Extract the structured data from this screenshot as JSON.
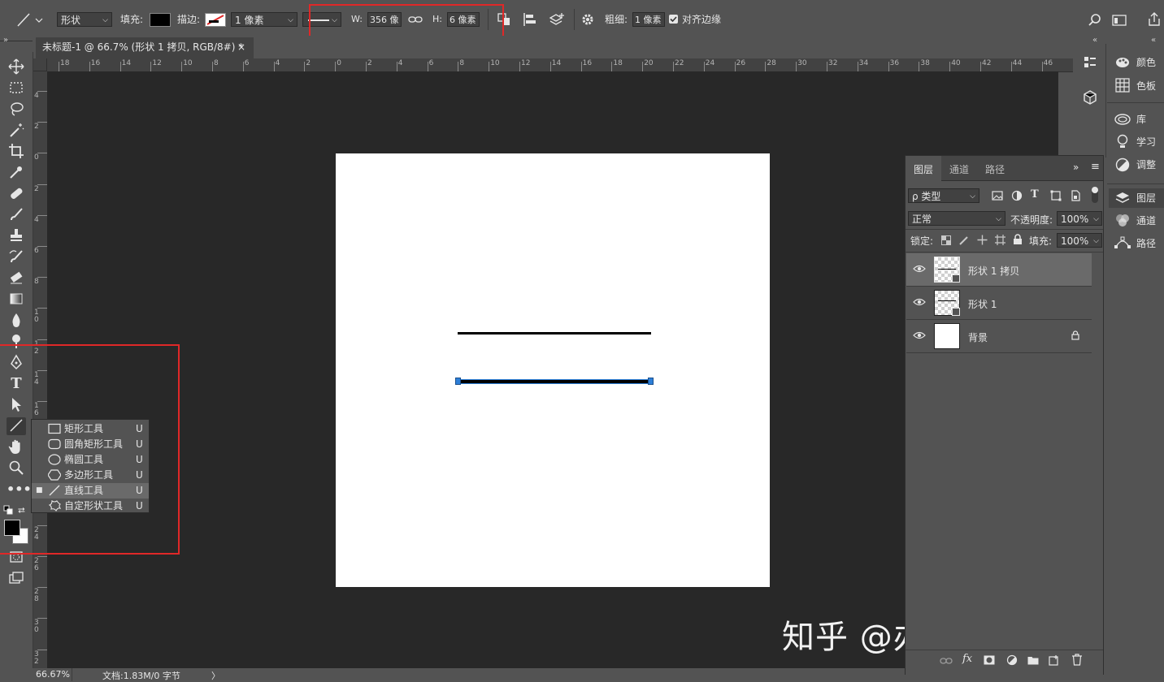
{
  "options_bar": {
    "mode": "形状",
    "fill_label": "填充:",
    "stroke_label": "描边:",
    "stroke_width": "1 像素",
    "w_label": "W:",
    "w_value": "356 像",
    "h_label": "H:",
    "h_value": "6 像素",
    "weight_label": "粗细:",
    "weight_value": "1 像素",
    "align_edges": "对齐边缘"
  },
  "document": {
    "tab_title": "未标题-1 @ 66.7% (形状 1 拷贝, RGB/8#) *",
    "tab_close": "×"
  },
  "ruler": {
    "h_ticks": [
      "18",
      "16",
      "14",
      "12",
      "10",
      "8",
      "6",
      "4",
      "2",
      "0",
      "2",
      "4",
      "6",
      "8",
      "10",
      "12",
      "14",
      "16",
      "18",
      "20",
      "22",
      "24",
      "26",
      "28",
      "30",
      "32",
      "34",
      "36",
      "38",
      "40",
      "42",
      "44",
      "46"
    ],
    "v_ticks": [
      "4",
      "2",
      "0",
      "2",
      "4",
      "6",
      "8",
      "1 0",
      "1 2",
      "1 4",
      "1 6",
      "1 8",
      "2 0",
      "2 2",
      "2 4",
      "2 6",
      "2 8",
      "3 0",
      "3 2"
    ]
  },
  "status": {
    "zoom": "66.67%",
    "doc_info": "文档:1.83M/0 字节",
    "arrow": "〉"
  },
  "tool_flyout": [
    {
      "label": "矩形工具",
      "key": "U"
    },
    {
      "label": "圆角矩形工具",
      "key": "U"
    },
    {
      "label": "椭圆工具",
      "key": "U"
    },
    {
      "label": "多边形工具",
      "key": "U"
    },
    {
      "label": "直线工具",
      "key": "U"
    },
    {
      "label": "自定形状工具",
      "key": "U"
    }
  ],
  "layers_panel": {
    "tabs": [
      "图层",
      "通道",
      "路径"
    ],
    "filter_kind": "ρ 类型",
    "blend_mode": "正常",
    "opacity_label": "不透明度:",
    "opacity_value": "100%",
    "lock_label": "锁定:",
    "fill_label": "填充:",
    "fill_value": "100%",
    "layers": [
      {
        "name": "形状 1 拷贝"
      },
      {
        "name": "形状 1"
      },
      {
        "name": "背景"
      }
    ]
  },
  "right_panels": {
    "group1": [
      "颜色",
      "色板"
    ],
    "group2": [
      "库",
      "学习",
      "调整"
    ],
    "group3": [
      "图层",
      "通道",
      "路径"
    ]
  },
  "watermark": "知乎 @办公黑科技砖家",
  "colors": {
    "accent_red": "#e02828",
    "ui_bg": "#535353",
    "canvas_bg": "#282828",
    "selection_blue": "#2d7fd8"
  }
}
